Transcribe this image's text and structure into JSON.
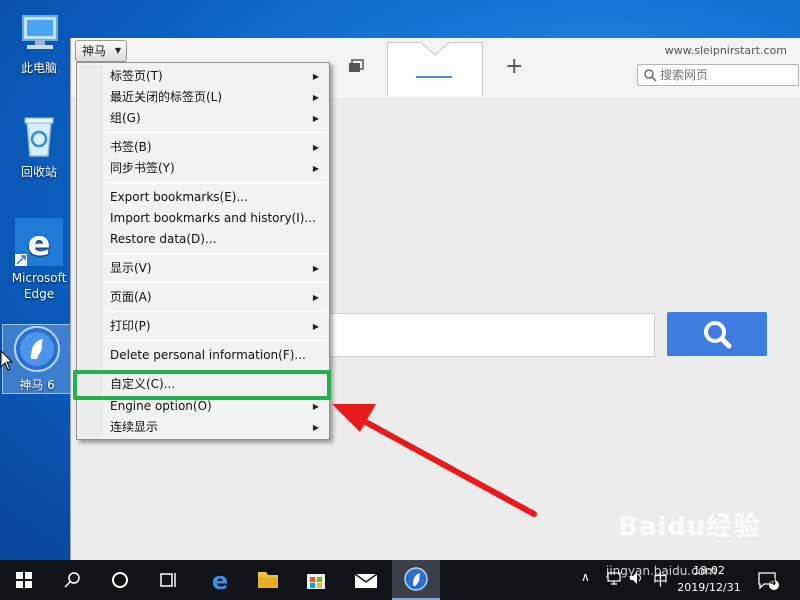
{
  "desktop": {
    "icons": [
      {
        "label": "此电脑"
      },
      {
        "label": "回收站"
      },
      {
        "label": "Microsoft Edge"
      },
      {
        "label": "神马 6"
      }
    ]
  },
  "browser": {
    "app_button": "神马",
    "url": "www.sleipnirstart.com",
    "search_placeholder": "搜索网页",
    "new_tab": "+"
  },
  "menu": {
    "items": [
      {
        "label": "标签页(T)",
        "submenu": true
      },
      {
        "label": "最近关闭的标签页(L)",
        "submenu": true
      },
      {
        "label": "组(G)",
        "submenu": true
      },
      {
        "label": "书签(B)",
        "submenu": true
      },
      {
        "label": "同步书签(Y)",
        "submenu": true
      },
      {
        "label": "Export bookmarks(E)...",
        "submenu": false
      },
      {
        "label": "Import bookmarks and history(I)...",
        "submenu": false
      },
      {
        "label": "Restore data(D)...",
        "submenu": false
      },
      {
        "label": "显示(V)",
        "submenu": true
      },
      {
        "label": "页面(A)",
        "submenu": true
      },
      {
        "label": "打印(P)",
        "submenu": true
      },
      {
        "label": "Delete personal information(F)...",
        "submenu": false
      },
      {
        "label": "自定义(C)...",
        "submenu": false
      },
      {
        "label": "Engine option(O)",
        "submenu": true
      },
      {
        "label": "连续显示",
        "submenu": true
      }
    ],
    "highlighted": "自定义(C)..."
  },
  "taskbar": {
    "ime": "中",
    "time": "18:02",
    "date": "2019/12/31",
    "notifications": "4"
  },
  "watermark": {
    "brand": "Baidu经验",
    "site": "jingyan.baidu.com"
  },
  "colors": {
    "highlight_box": "#22b14c",
    "arrow": "#e8191a",
    "search_button": "#3d7de0"
  }
}
